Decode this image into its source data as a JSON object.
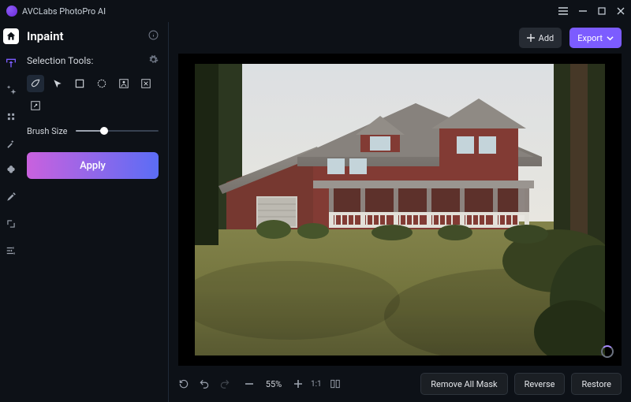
{
  "app": {
    "title": "AVCLabs PhotoPro AI"
  },
  "sidebar": {
    "title": "Inpaint",
    "section_label": "Selection Tools:",
    "brush_label": "Brush Size",
    "brush_percent": 35,
    "apply_label": "Apply",
    "tools": [
      "brush",
      "lasso",
      "rectangle",
      "ellipse",
      "person",
      "object",
      "magic"
    ],
    "selected_tool": "brush"
  },
  "topbar": {
    "add_label": "Add",
    "export_label": "Export"
  },
  "bottombar": {
    "zoom_label": "55%",
    "remove_all_mask": "Remove All Mask",
    "reverse": "Reverse",
    "restore": "Restore"
  }
}
